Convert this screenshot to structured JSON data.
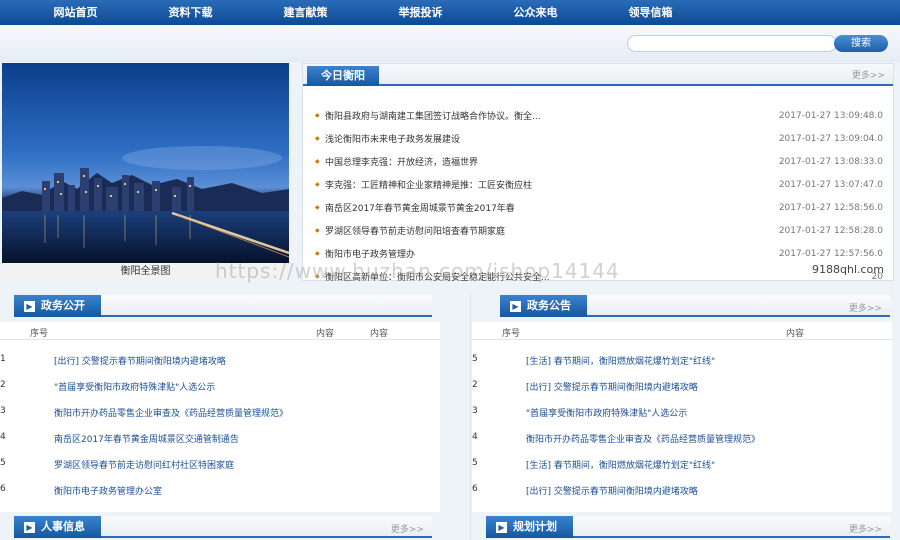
{
  "nav": [
    "网站首页",
    "资料下载",
    "建言献策",
    "举报投诉",
    "公众来电",
    "领导信箱"
  ],
  "search": {
    "placeholder": "",
    "button": "搜索"
  },
  "photo": {
    "caption": "衡阳全景图"
  },
  "news": {
    "tab": "今日衡阳",
    "more": "更多>>",
    "items": [
      {
        "title": "衡阳县政府与湖南建工集团签订战略合作协议。衡全...",
        "date": "2017-01-27 13:09:48.0"
      },
      {
        "title": "浅论衡阳市未来电子政务发展建设",
        "date": "2017-01-27 13:09:04.0"
      },
      {
        "title": "中国总理李克强：开放经济，造福世界",
        "date": "2017-01-27 13:08:33.0"
      },
      {
        "title": "李克强：工匠精神和企业家精神是推：工匠安衡应柱",
        "date": "2017-01-27 13:07:47.0"
      },
      {
        "title": "南岳区2017年春节黄金周城景节黄金2017年春",
        "date": "2017-01-27 12:58:56.0"
      },
      {
        "title": "罗湖区领导春节前走访慰问阳培查春节期家庭",
        "date": "2017-01-27 12:58:28.0"
      },
      {
        "title": "衡阳市电子政务管理办",
        "date": "2017-01-27 12:57:56.0"
      },
      {
        "title": "衡阳区高新单位：衡阳市公安局安全稳定能行公共安全...",
        "date": "20"
      }
    ]
  },
  "gov": {
    "tab": "政务公开",
    "col_num": "序号",
    "col_content": "内容",
    "col_content2": "内容",
    "rows": [
      {
        "num": "1",
        "text": "[出行] 交警提示春节期间衡阳境内避堵攻略"
      },
      {
        "num": "2",
        "text": "\"首届享受衡阳市政府特殊津贴\"人选公示"
      },
      {
        "num": "3",
        "text": "衡阳市开办药品零售企业审查及《药品经营质量管理规范》"
      },
      {
        "num": "4",
        "text": "南岳区2017年春节黄金周城景区交通管制通告"
      },
      {
        "num": "5",
        "text": "罗湖区领导春节前走访慰问红村社区特困家庭"
      },
      {
        "num": "6",
        "text": "衡阳市电子政务管理办公室"
      }
    ]
  },
  "notice": {
    "tab": "政务公告",
    "more": "更多>>",
    "col_num": "序号",
    "col_content": "内容",
    "rows": [
      {
        "num": "5",
        "text": "[生活] 春节期间，衡阳燃放烟花爆竹划定\"红线\""
      },
      {
        "num": "2",
        "text": "[出行] 交警提示春节期间衡阳境内避堵攻略"
      },
      {
        "num": "3",
        "text": "\"首届享受衡阳市政府特殊津贴\"人选公示"
      },
      {
        "num": "4",
        "text": "衡阳市开办药品零售企业审查及《药品经营质量管理规范》"
      },
      {
        "num": "5",
        "text": "[生活] 春节期间，衡阳燃放烟花爆竹划定\"红线\""
      },
      {
        "num": "6",
        "text": "[出行] 交警提示春节期间衡阳境内避堵攻略"
      }
    ]
  },
  "hr": {
    "tab": "人事信息",
    "more": "更多>>"
  },
  "plan": {
    "tab": "规划计划",
    "more": "更多>>"
  },
  "watermark": {
    "text": "https://www.huzhan.com/ishop14144",
    "side": "9188qhl.com"
  }
}
